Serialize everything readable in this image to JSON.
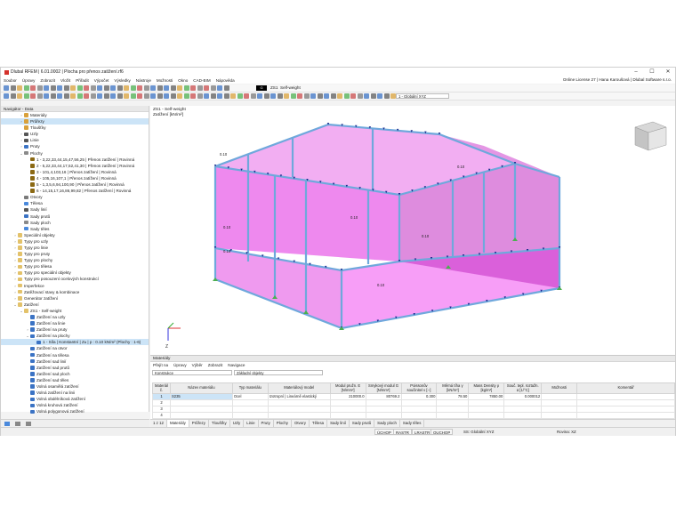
{
  "window": {
    "title": "Dlubal RFEM | 6.01.0002 | Plocha pro přenos zatížení.rf6",
    "min": "–",
    "max": "☐",
    "close": "✕"
  },
  "menu": {
    "items": [
      "Soubor",
      "Úpravy",
      "Zobrazit",
      "Vložit",
      "Přiřadit",
      "Výpočet",
      "Výsledky",
      "Nástroje",
      "Možnosti",
      "Okno",
      "CAD-BIM",
      "Nápověda"
    ],
    "license": "Online License 27 | Hana Karoušová | Dlubal Software s.r.o."
  },
  "toolbar": {
    "lc_code": "G",
    "lc_id": "ZS1",
    "lc_name": "Self-weight",
    "coord_system": "1 - Globální XYZ"
  },
  "navigator": {
    "title": "Navigátor - Data",
    "items": [
      {
        "label": "Materiály",
        "level": 1,
        "arrow": "›",
        "icon": "#d9a13b"
      },
      {
        "label": "Průřezy",
        "level": 1,
        "arrow": "›",
        "icon": "#d9a13b",
        "selected": true
      },
      {
        "label": "Tloušťky",
        "level": 1,
        "arrow": "",
        "icon": "#d9a13b"
      },
      {
        "label": "Uzly",
        "level": 1,
        "arrow": "›",
        "icon": "#555555"
      },
      {
        "label": "Linie",
        "level": 1,
        "arrow": "›",
        "icon": "#555555"
      },
      {
        "label": "Pruty",
        "level": 1,
        "arrow": "›",
        "icon": "#3b73c4"
      },
      {
        "label": "Plochy",
        "level": 1,
        "arrow": "⌄",
        "icon": "#8a8a8a"
      },
      {
        "label": "1 - 3,22,33,44,15,47,56,25 | Přenos zatížení | Rovinná",
        "level": 2,
        "arrow": "",
        "icon": "#8b6914"
      },
      {
        "label": "2 - 5,22,33,44,17,52,41,30 | Přenos zatížení | Rovinná",
        "level": 2,
        "arrow": "",
        "icon": "#8b6914"
      },
      {
        "label": "3 - 101,4,103,16 | Přenos zatížení | Rovinná",
        "level": 2,
        "arrow": "",
        "icon": "#8b6914"
      },
      {
        "label": "4 - 105,16,107,1 | Přenos zatížení | Rovinná",
        "level": 2,
        "arrow": "",
        "icon": "#8b6914"
      },
      {
        "label": "5 - 1,3,5,6,94,100,90 | Přenos zatížení | Rovinná",
        "level": 2,
        "arrow": "",
        "icon": "#8b6914"
      },
      {
        "label": "6 - 14,15,17,16,86,99,82 | Přenos zatížení | Rovinná",
        "level": 2,
        "arrow": "",
        "icon": "#8b6914"
      },
      {
        "label": "Otvory",
        "level": 1,
        "arrow": "",
        "icon": "#7a7a7a"
      },
      {
        "label": "Tělesa",
        "level": 1,
        "arrow": "",
        "icon": "#4a89dc"
      },
      {
        "label": "Sady linií",
        "level": 1,
        "arrow": "",
        "icon": "#555555"
      },
      {
        "label": "Sady prutů",
        "level": 1,
        "arrow": "",
        "icon": "#3b73c4"
      },
      {
        "label": "Sady ploch",
        "level": 1,
        "arrow": "",
        "icon": "#8a8a8a"
      },
      {
        "label": "Sady těles",
        "level": 1,
        "arrow": "",
        "icon": "#4a89dc"
      },
      {
        "label": "Speciální objekty",
        "level": 0,
        "arrow": "›",
        "icon": "#e3c26a"
      },
      {
        "label": "Typy pro uzly",
        "level": 0,
        "arrow": "›",
        "icon": "#e3c26a"
      },
      {
        "label": "Typy pro linie",
        "level": 0,
        "arrow": "›",
        "icon": "#e3c26a"
      },
      {
        "label": "Typy pro pruty",
        "level": 0,
        "arrow": "›",
        "icon": "#e3c26a"
      },
      {
        "label": "Typy pro plochy",
        "level": 0,
        "arrow": "›",
        "icon": "#e3c26a"
      },
      {
        "label": "Typy pro tělesa",
        "level": 0,
        "arrow": "›",
        "icon": "#e3c26a"
      },
      {
        "label": "Typy pro speciální objekty",
        "level": 0,
        "arrow": "›",
        "icon": "#e3c26a"
      },
      {
        "label": "Typy pro posouzení ocelových konstrukcí",
        "level": 0,
        "arrow": "›",
        "icon": "#e3c26a"
      },
      {
        "label": "Imperfekce",
        "level": 0,
        "arrow": "›",
        "icon": "#e3c26a"
      },
      {
        "label": "Zatěžovací stavy & kombinace",
        "level": 0,
        "arrow": "›",
        "icon": "#e3c26a"
      },
      {
        "label": "Generátor zatížení",
        "level": 0,
        "arrow": "›",
        "icon": "#e3c26a"
      },
      {
        "label": "Zatížení",
        "level": 0,
        "arrow": "⌄",
        "icon": "#e3c26a"
      },
      {
        "label": "ZS1 - Self-weight",
        "level": 1,
        "arrow": "⌄",
        "icon": "#e3c26a"
      },
      {
        "label": "Zatížení na uzly",
        "level": 2,
        "arrow": "",
        "icon": "#3b73c4"
      },
      {
        "label": "Zatížení na linie",
        "level": 2,
        "arrow": "",
        "icon": "#3b73c4"
      },
      {
        "label": "Zatížení na pruty",
        "level": 2,
        "arrow": "›",
        "icon": "#3b73c4"
      },
      {
        "label": "Zatížení na plochy",
        "level": 2,
        "arrow": "⌄",
        "icon": "#3b73c4"
      },
      {
        "label": "1 - Síla | Konstantní | Zᴀ | p : 0.10 kN/m² (Plochy : 1-6)",
        "level": 3,
        "arrow": "",
        "icon": "#3b73c4",
        "selected": true
      },
      {
        "label": "Zatížení na otvor",
        "level": 2,
        "arrow": "",
        "icon": "#3b73c4"
      },
      {
        "label": "Zatížení na tělesa",
        "level": 2,
        "arrow": "",
        "icon": "#3b73c4"
      },
      {
        "label": "Zatížení sad linií",
        "level": 2,
        "arrow": "",
        "icon": "#3b73c4"
      },
      {
        "label": "Zatížení sad prutů",
        "level": 2,
        "arrow": "",
        "icon": "#3b73c4"
      },
      {
        "label": "Zatížení sad ploch",
        "level": 2,
        "arrow": "",
        "icon": "#3b73c4"
      },
      {
        "label": "Zatížení sad těles",
        "level": 2,
        "arrow": "",
        "icon": "#3b73c4"
      },
      {
        "label": "Volná osamělá zatížení",
        "level": 2,
        "arrow": "",
        "icon": "#3b73c4"
      },
      {
        "label": "Volná zatížení na linii",
        "level": 2,
        "arrow": "",
        "icon": "#3b73c4"
      },
      {
        "label": "Volná obdélníková zatížení",
        "level": 2,
        "arrow": "",
        "icon": "#3b73c4"
      },
      {
        "label": "Volná kruhová zatížení",
        "level": 2,
        "arrow": "",
        "icon": "#3b73c4"
      },
      {
        "label": "Volná polygonová zatížení",
        "level": 2,
        "arrow": "",
        "icon": "#3b73c4"
      }
    ]
  },
  "viewport": {
    "title_line1": "ZS1 - Self-weight",
    "title_line2": "Zatížení [kN/m²]",
    "load_labels": [
      "0.10",
      "0.10",
      "0.10",
      "0.10",
      "0.10",
      "0.10",
      "0.10"
    ],
    "axis_z": "Z"
  },
  "materials_panel": {
    "title": "Materiály",
    "menu": [
      "Přejít na",
      "Úpravy",
      "Výběr",
      "Zobrazit",
      "Navigace"
    ],
    "filter1": "Konstrukce",
    "filter2": "Základní objekty",
    "headers": [
      "Materiál č.",
      "Název materiálu",
      "Typ materiálu",
      "Materiálový model",
      "Modul pružn. E [N/mm²]",
      "Smykový modul G [N/mm²]",
      "Poissonův součinitel ν [--]",
      "Měrná tíha γ [kN/m³]",
      "Mass Density ρ [kg/m³]",
      "Souč. tepl. roztažn. α [1/°C]",
      "Možnosti",
      "Komentář"
    ],
    "rows": [
      [
        "1",
        "S235",
        "Ocel",
        "Izotropní | Lineárně elastický",
        "210000.0",
        "80769.2",
        "0.300",
        "78.50",
        "7850.00",
        "0.000012",
        "",
        ""
      ],
      [
        "2",
        "",
        "",
        "",
        "",
        "",
        "",
        "",
        "",
        "",
        "",
        ""
      ],
      [
        "3",
        "",
        "",
        "",
        "",
        "",
        "",
        "",
        "",
        "",
        "",
        ""
      ],
      [
        "4",
        "",
        "",
        "",
        "",
        "",
        "",
        "",
        "",
        "",
        "",
        ""
      ],
      [
        "5",
        "",
        "",
        "",
        "",
        "",
        "",
        "",
        "",
        "",
        "",
        ""
      ]
    ],
    "pager": "1 z 12"
  },
  "tabs": [
    "Materiály",
    "Průřezy",
    "Tloušťky",
    "Uzly",
    "Linie",
    "Pruty",
    "Plochy",
    "Otvory",
    "Tělesa",
    "Sady linií",
    "Sady prutů",
    "Sady ploch",
    "Sady těles"
  ],
  "status": {
    "buttons": [
      "ÚCHOP",
      "RASTR",
      "LRASTR",
      "OUCHOP"
    ],
    "cs": "SS: Globální XYZ",
    "plane": "Rovina: XZ"
  }
}
